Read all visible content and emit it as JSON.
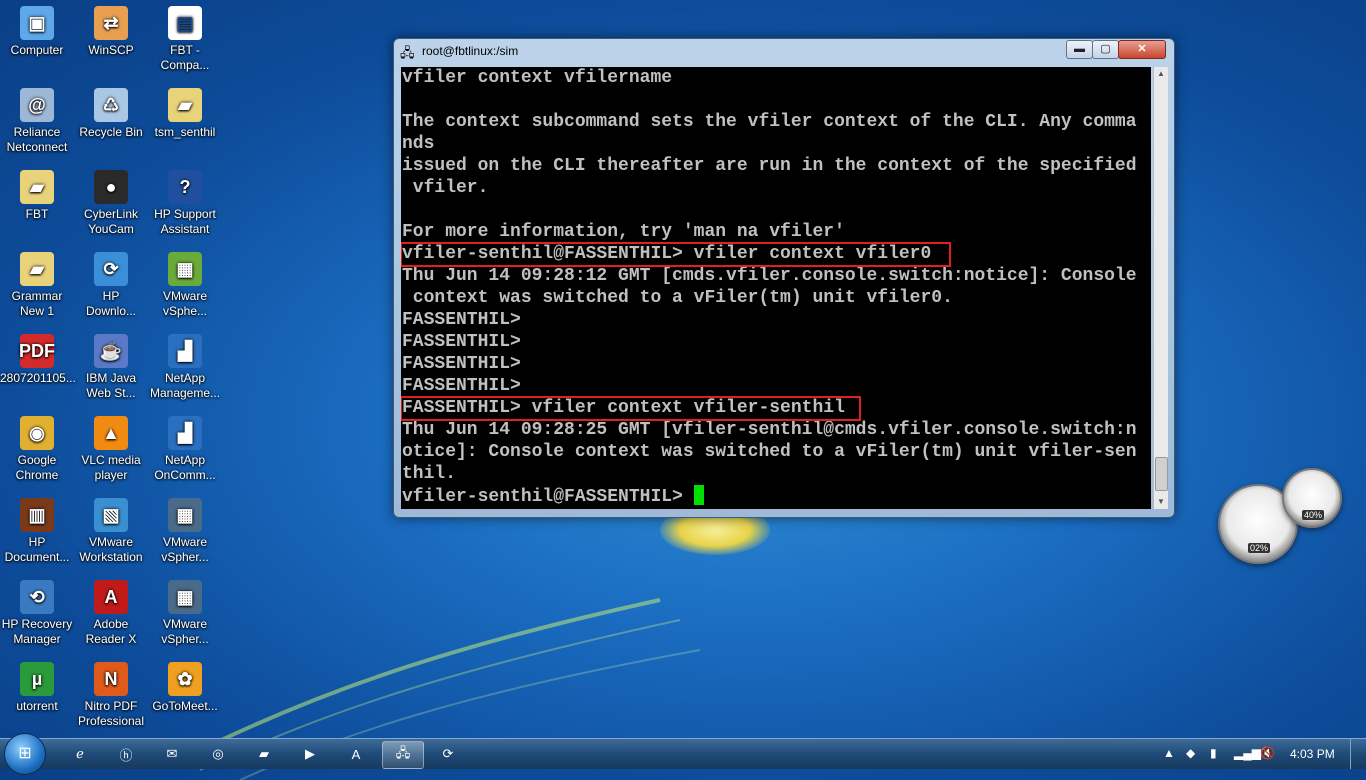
{
  "desktop_icons": [
    {
      "label": "Computer",
      "glyph": "▣",
      "color": "#5ea7e8"
    },
    {
      "label": "WinSCP",
      "glyph": "⇄",
      "color": "#e8a050"
    },
    {
      "label": "FBT -\nCompa...",
      "glyph": "▤",
      "color": "#ffffff"
    },
    {
      "label": "Reliance\nNetconnect",
      "glyph": "@",
      "color": "#9db7d6"
    },
    {
      "label": "Recycle Bin",
      "glyph": "♺",
      "color": "#a9c8e6"
    },
    {
      "label": "tsm_senthil",
      "glyph": "▰",
      "color": "#e8d27a"
    },
    {
      "label": "FBT",
      "glyph": "▰",
      "color": "#e8d27a"
    },
    {
      "label": "CyberLink\nYouCam",
      "glyph": "●",
      "color": "#2a2a2a"
    },
    {
      "label": "HP Support\nAssistant",
      "glyph": "?",
      "color": "#1f4f9e"
    },
    {
      "label": "Grammar\nNew 1",
      "glyph": "▰",
      "color": "#e8d27a"
    },
    {
      "label": "HP\nDownlo...",
      "glyph": "⟳",
      "color": "#3b8fd8"
    },
    {
      "label": "VMware\nvSphe...",
      "glyph": "▦",
      "color": "#6aaa3a"
    },
    {
      "label": "2807201105...",
      "glyph": "PDF",
      "color": "#d42a2a"
    },
    {
      "label": "IBM Java\nWeb St...",
      "glyph": "☕",
      "color": "#5a7ac8"
    },
    {
      "label": "NetApp\nManageme...",
      "glyph": "▟",
      "color": "#2a6fc0"
    },
    {
      "label": "Google\nChrome",
      "glyph": "◉",
      "color": "#e0b030"
    },
    {
      "label": "VLC media\nplayer",
      "glyph": "▲",
      "color": "#f08a10"
    },
    {
      "label": "NetApp\nOnComm...",
      "glyph": "▟",
      "color": "#2a6fc0"
    },
    {
      "label": "HP\nDocument...",
      "glyph": "▥",
      "color": "#7a3a1a"
    },
    {
      "label": "VMware\nWorkstation",
      "glyph": "▧",
      "color": "#3a8fd0"
    },
    {
      "label": "VMware\nvSpher...",
      "glyph": "▦",
      "color": "#4a6a8a"
    },
    {
      "label": "HP Recovery\nManager",
      "glyph": "⟲",
      "color": "#3a7ac0"
    },
    {
      "label": "Adobe\nReader X",
      "glyph": "A",
      "color": "#c01a1a"
    },
    {
      "label": "VMware\nvSpher...",
      "glyph": "▦",
      "color": "#4a6a8a"
    },
    {
      "label": "utorrent",
      "glyph": "µ",
      "color": "#2a9a3a"
    },
    {
      "label": "Nitro PDF\nProfessional",
      "glyph": "N",
      "color": "#e05a1a"
    },
    {
      "label": "GoToMeet...",
      "glyph": "✿",
      "color": "#f0a020"
    }
  ],
  "terminal_window": {
    "title": "root@fbtlinux:/sim",
    "minimize_label": "▬",
    "maximize_label": "▢",
    "close_label": "✕",
    "lines": [
      "vfiler context vfilername",
      "",
      "The context subcommand sets the vfiler context of the CLI. Any comma",
      "nds",
      "issued on the CLI thereafter are run in the context of the specified",
      " vfiler.",
      "",
      "For more information, try 'man na vfiler'",
      "vfiler-senthil@FASSENTHIL> vfiler context vfiler0",
      "Thu Jun 14 09:28:12 GMT [cmds.vfiler.console.switch:notice]: Console",
      " context was switched to a vFiler(tm) unit vfiler0.",
      "FASSENTHIL>",
      "FASSENTHIL>",
      "FASSENTHIL>",
      "FASSENTHIL>",
      "FASSENTHIL> vfiler context vfiler-senthil",
      "Thu Jun 14 09:28:25 GMT [vfiler-senthil@cmds.vfiler.console.switch:n",
      "otice]: Console context was switched to a vFiler(tm) unit vfiler-sen",
      "thil."
    ],
    "prompt": "vfiler-senthil@FASSENTHIL> "
  },
  "gadget": {
    "gauge_cpu_label": "02%",
    "gauge_mem_label": "40%"
  },
  "taskbar": {
    "start_icon": "windows-logo",
    "pinned": [
      "ie-icon",
      "hp-icon",
      "mail-icon",
      "media-icon",
      "explorer-icon",
      "media-player-icon",
      "pdf-icon",
      "putty-icon",
      "remote-icon"
    ],
    "clock": "4:03 PM"
  }
}
